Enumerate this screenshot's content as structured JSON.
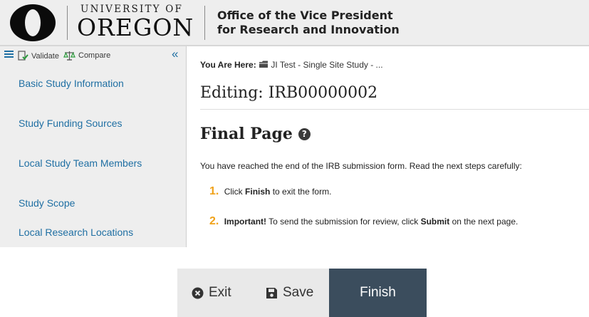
{
  "header": {
    "university": "UNIVERSITY OF",
    "oregon": "OREGON",
    "office_line1": "Office of the Vice President",
    "office_line2": "for Research and Innovation"
  },
  "sidebar": {
    "validate_label": "Validate",
    "compare_label": "Compare",
    "items": [
      {
        "label": "Basic Study Information"
      },
      {
        "label": "Study Funding Sources"
      },
      {
        "label": "Local Study Team Members"
      },
      {
        "label": "Study Scope"
      },
      {
        "label": "Local Research Locations"
      }
    ]
  },
  "main": {
    "you_are_here_label": "You Are Here:",
    "breadcrumb_text": "JI Test - Single Site Study - ...",
    "editing_title": "Editing: IRB00000002",
    "section_title": "Final Page",
    "intro": "You have reached the end of the IRB submission form. Read the next steps carefully:",
    "step1": {
      "num": "1.",
      "pre": "Click",
      "bold": "Finish",
      "post": "to exit the form."
    },
    "step2": {
      "num": "2.",
      "bold1": "Important!",
      "pre": "To send the submission for review, click",
      "bold2": "Submit",
      "post": "on the next page."
    }
  },
  "actions": {
    "exit_label": "Exit",
    "save_label": "Save",
    "finish_label": "Finish"
  },
  "colors": {
    "link": "#1f6fa3",
    "step_number": "#f0a21a",
    "finish_bg": "#3b4d5d"
  }
}
